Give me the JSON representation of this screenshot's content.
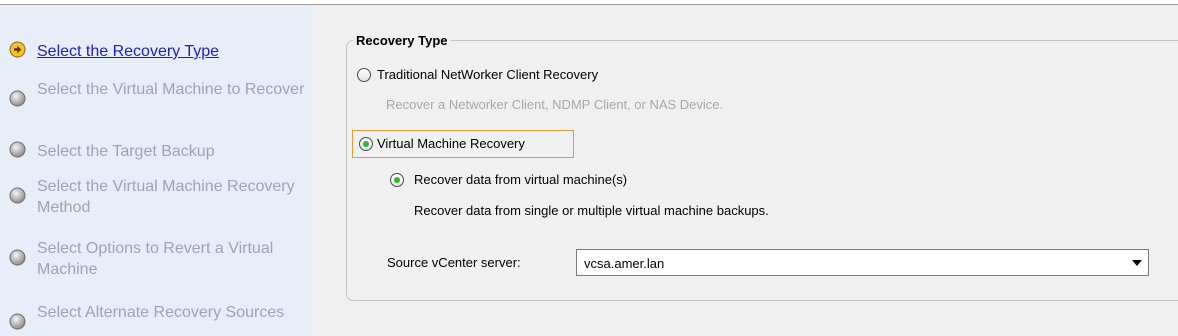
{
  "wizard": {
    "steps": [
      {
        "label": "Select the Recovery Type",
        "state": "current",
        "icon": "current-step-arrow-icon"
      },
      {
        "label": "Select the Virtual Machine to Recover",
        "state": "pending",
        "icon": "pending-step-circle-icon"
      },
      {
        "label": "Select the Target Backup",
        "state": "pending",
        "icon": "pending-step-circle-icon"
      },
      {
        "label": "Select the Virtual Machine Recovery Method",
        "state": "pending",
        "icon": "pending-step-circle-icon"
      },
      {
        "label": "Select Options to Revert a Virtual Machine",
        "state": "pending",
        "icon": "pending-step-circle-icon"
      },
      {
        "label": "Select Alternate Recovery Sources",
        "state": "pending",
        "icon": "pending-step-circle-icon"
      }
    ]
  },
  "recovery_type": {
    "legend": "Recovery Type",
    "traditional": {
      "label": "Traditional NetWorker Client Recovery",
      "description": "Recover a Networker Client, NDMP Client, or NAS Device.",
      "checked": false
    },
    "vm": {
      "label": "Virtual Machine Recovery",
      "checked": true,
      "sub_option": {
        "label": "Recover data from virtual machine(s)",
        "description": "Recover data from single or multiple virtual machine backups.",
        "checked": true
      }
    },
    "source_vcenter": {
      "label": "Source vCenter server:",
      "value": "vcsa.amer.lan"
    }
  },
  "colors": {
    "sidebar_bg": "#e7eef8",
    "current_step_link": "#1e1ec8",
    "pending_step_text": "#9aa4b4",
    "radio_checked_dot": "#2fb52f",
    "focus_outline": "#e79a3c",
    "current_step_icon": "#f4b400"
  }
}
